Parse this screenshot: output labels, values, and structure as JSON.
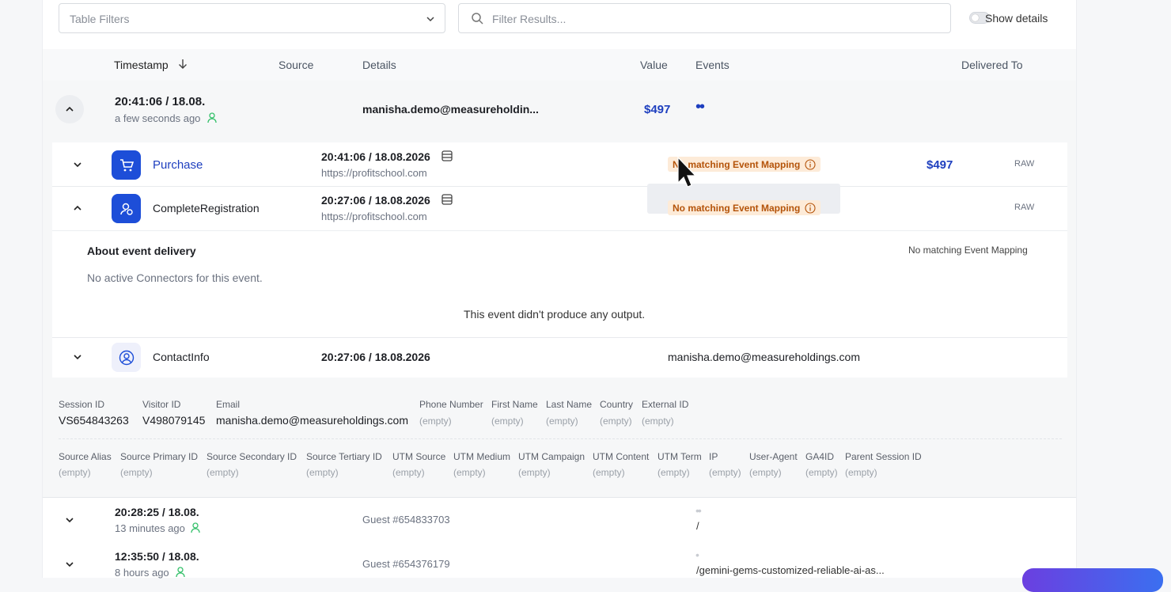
{
  "toolbar": {
    "filter_placeholder": "Table Filters",
    "search_placeholder": "Filter Results...",
    "show_details_label": "Show details"
  },
  "table_headers": {
    "timestamp": "Timestamp",
    "source": "Source",
    "details": "Details",
    "value": "Value",
    "events": "Events",
    "delivered_to": "Delivered To"
  },
  "session1": {
    "time": "20:41:06 / 18.08.",
    "relative": "a few seconds ago",
    "details": "manisha.demo@measureholdin...",
    "value": "$497",
    "events_dots": "••"
  },
  "events": [
    {
      "name": "Purchase",
      "time": "20:41:06 / 18.08.2026",
      "url": "https://profitschool.com",
      "badge": "No matching Event Mapping",
      "value": "$497",
      "delivered": "RAW"
    },
    {
      "name": "CompleteRegistration",
      "time": "20:27:06 / 18.08.2026",
      "url": "https://profitschool.com",
      "badge": "No matching Event Mapping",
      "delivered": "RAW"
    },
    {
      "name": "ContactInfo",
      "time": "20:27:06 / 18.08.2026",
      "email": "manisha.demo@measureholdings.com"
    }
  ],
  "delivery": {
    "title": "About event delivery",
    "mapping": "No matching Event Mapping",
    "no_connectors": "No active Connectors for this event.",
    "no_output": "This event didn't produce any output."
  },
  "fields_row1": [
    {
      "label": "Session ID",
      "value": "VS654843263"
    },
    {
      "label": "Visitor ID",
      "value": "V498079145"
    },
    {
      "label": "Email",
      "value": "manisha.demo@measureholdings.com"
    },
    {
      "label": "Phone Number",
      "value": "(empty)"
    },
    {
      "label": "First Name",
      "value": "(empty)"
    },
    {
      "label": "Last Name",
      "value": "(empty)"
    },
    {
      "label": "Country",
      "value": "(empty)"
    },
    {
      "label": "External ID",
      "value": "(empty)"
    }
  ],
  "fields_row2": [
    {
      "label": "Source Alias",
      "value": "(empty)"
    },
    {
      "label": "Source Primary ID",
      "value": "(empty)"
    },
    {
      "label": "Source Secondary ID",
      "value": "(empty)"
    },
    {
      "label": "Source Tertiary ID",
      "value": "(empty)"
    },
    {
      "label": "UTM Source",
      "value": "(empty)"
    },
    {
      "label": "UTM Medium",
      "value": "(empty)"
    },
    {
      "label": "UTM Campaign",
      "value": "(empty)"
    },
    {
      "label": "UTM Content",
      "value": "(empty)"
    },
    {
      "label": "UTM Term",
      "value": "(empty)"
    },
    {
      "label": "IP",
      "value": "(empty)"
    },
    {
      "label": "User-Agent",
      "value": "(empty)"
    },
    {
      "label": "GA4ID",
      "value": "(empty)"
    },
    {
      "label": "Parent Session ID",
      "value": "(empty)"
    }
  ],
  "session2": {
    "time": "20:28:25 / 18.08.",
    "relative": "13 minutes ago",
    "details": "Guest #654833703",
    "events_dots": "••",
    "path": "/"
  },
  "session3": {
    "time": "12:35:50 / 18.08.",
    "relative": "8 hours ago",
    "details": "Guest #654376179",
    "events_dots": "•",
    "path": "/gemini-gems-customized-reliable-ai-as..."
  },
  "colors": {
    "accent": "#1d4ed8",
    "badge_bg": "#fdebd8",
    "badge_text": "#b45309",
    "online": "#34c06a"
  }
}
